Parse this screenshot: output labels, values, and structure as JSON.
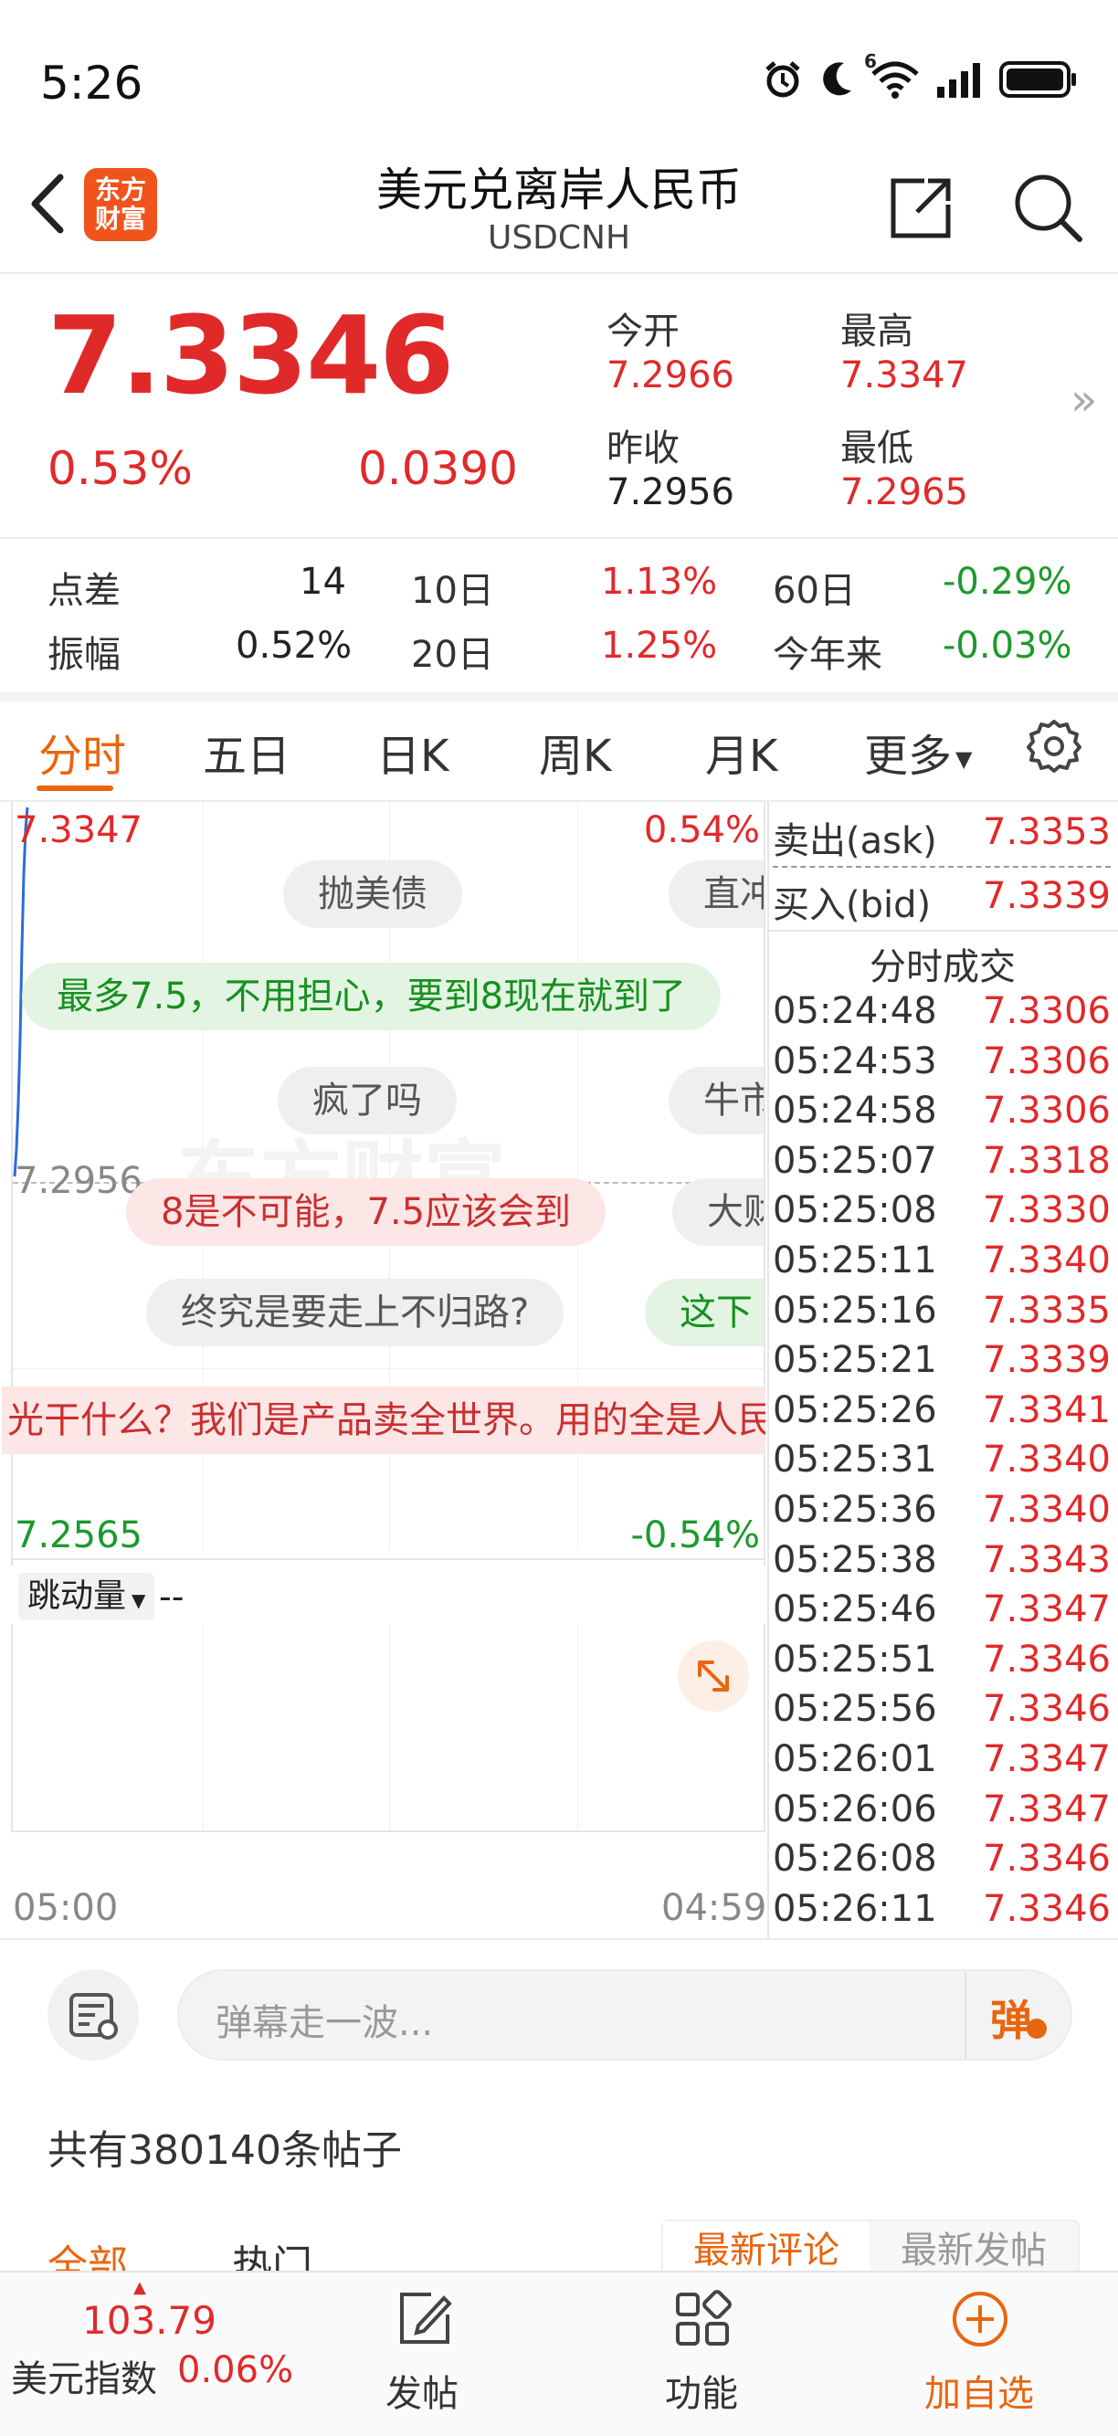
{
  "status": {
    "time": "5:26",
    "network": "6"
  },
  "header": {
    "title": "美元兑离岸人民币",
    "subtitle": "USDCNH",
    "logo_line1": "东方",
    "logo_line2": "财富"
  },
  "quote": {
    "price": "7.3346",
    "change_pct": "0.53%",
    "change": "0.0390",
    "open_label": "今开",
    "open": "7.2966",
    "high_label": "最高",
    "high": "7.3347",
    "prev_close_label": "昨收",
    "prev_close": "7.2956",
    "low_label": "最低",
    "low": "7.2965",
    "more_chevron": "»"
  },
  "metrics": {
    "spread_label": "点差",
    "spread": "14",
    "d10_label": "10日",
    "d10": "1.13%",
    "d60_label": "60日",
    "d60": "-0.29%",
    "amp_label": "振幅",
    "amp": "0.52%",
    "d20_label": "20日",
    "d20": "1.25%",
    "ytd_label": "今年来",
    "ytd": "-0.03%"
  },
  "tabs": [
    "分时",
    "五日",
    "日K",
    "周K",
    "月K",
    "更多"
  ],
  "chart": {
    "top_price": "7.3347",
    "top_pct": "0.54%",
    "mid_price": "7.2956",
    "bottom_price": "7.2565",
    "bottom_pct": "-0.54%",
    "watermark": "东方财富",
    "indicator": "跳动量",
    "indicator_value": "--",
    "time_start": "05:00",
    "time_end": "04:59",
    "danmu": [
      "抛美债",
      "直冲",
      "最多7.5，不用担心，要到8现在就到了",
      "疯了吗",
      "牛市",
      "8是不可能，7.5应该会到",
      "大财",
      "终究是要走上不归路?",
      "这下",
      "光干什么？我们是产品卖全世界。用的全是人民币"
    ]
  },
  "orderbook": {
    "ask_label": "卖出(ask)",
    "ask": "7.3353",
    "bid_label": "买入(bid)",
    "bid": "7.3339",
    "ticks_title": "分时成交",
    "ticks": [
      {
        "t": "05:24:48",
        "p": "7.3306"
      },
      {
        "t": "05:24:53",
        "p": "7.3306"
      },
      {
        "t": "05:24:58",
        "p": "7.3306"
      },
      {
        "t": "05:25:07",
        "p": "7.3318"
      },
      {
        "t": "05:25:08",
        "p": "7.3330"
      },
      {
        "t": "05:25:11",
        "p": "7.3340"
      },
      {
        "t": "05:25:16",
        "p": "7.3335"
      },
      {
        "t": "05:25:21",
        "p": "7.3339"
      },
      {
        "t": "05:25:26",
        "p": "7.3341"
      },
      {
        "t": "05:25:31",
        "p": "7.3340"
      },
      {
        "t": "05:25:36",
        "p": "7.3340"
      },
      {
        "t": "05:25:38",
        "p": "7.3343"
      },
      {
        "t": "05:25:46",
        "p": "7.3347"
      },
      {
        "t": "05:25:51",
        "p": "7.3346"
      },
      {
        "t": "05:25:56",
        "p": "7.3346"
      },
      {
        "t": "05:26:01",
        "p": "7.3347"
      },
      {
        "t": "05:26:06",
        "p": "7.3347"
      },
      {
        "t": "05:26:08",
        "p": "7.3346"
      },
      {
        "t": "05:26:11",
        "p": "7.3346"
      }
    ]
  },
  "comment_input": {
    "placeholder": "弹幕走一波...",
    "send_label": "弹"
  },
  "posts": {
    "count_text": "共有380140条帖子",
    "tab_all": "全部",
    "tab_hot": "热门",
    "sort_latest_comment": "最新评论",
    "sort_latest_post": "最新发帖"
  },
  "bottom_nav": {
    "index_value": "103.79",
    "index_name": "美元指数",
    "index_pct": "0.06%",
    "post": "发帖",
    "func": "功能",
    "add_watch": "加自选"
  },
  "colors": {
    "up": "#e02a2a",
    "down": "#1c9a2c",
    "accent": "#e9650f",
    "logo": "#f1531c"
  }
}
